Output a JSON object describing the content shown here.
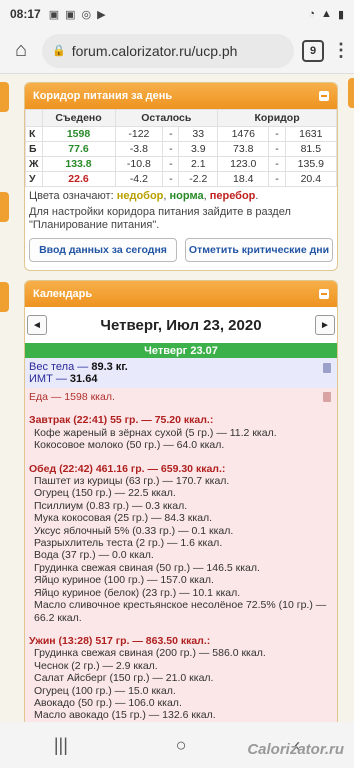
{
  "status": {
    "time": "08:17",
    "icons": [
      "image-icon",
      "image-icon",
      "instagram-icon",
      "youtube-icon"
    ],
    "battery": "▮"
  },
  "browser": {
    "url": "forum.calorizator.ru/ucp.ph",
    "tabs": "9"
  },
  "corridor": {
    "title": "Коридор питания за день",
    "headers": [
      "",
      "Съедено",
      "Осталось",
      "",
      "",
      "Коридор",
      "",
      ""
    ],
    "rows": [
      {
        "label": "К",
        "eaten": "1598",
        "left1": "-122",
        "left2": "33",
        "c1": "1476",
        "c2": "1631",
        "color": "green"
      },
      {
        "label": "Б",
        "eaten": "77.6",
        "left1": "-3.8",
        "left2": "3.9",
        "c1": "73.8",
        "c2": "81.5",
        "color": "green"
      },
      {
        "label": "Ж",
        "eaten": "133.8",
        "left1": "-10.8",
        "left2": "2.1",
        "c1": "123.0",
        "c2": "135.9",
        "color": "green"
      },
      {
        "label": "У",
        "eaten": "22.6",
        "left1": "-4.2",
        "left2": "-2.2",
        "c1": "18.4",
        "c2": "20.4",
        "color": "red"
      }
    ],
    "colors_label": "Цвета означают:",
    "legend_under": "недобор",
    "legend_norm": "норма",
    "legend_over": "перебор",
    "hint": "Для настройки коридора питания зайдите в раздел \"Планирование питания\".",
    "btn_today": "Ввод данных за сегодня",
    "btn_critical": "Отметить критические дни"
  },
  "calendar": {
    "title": "Календарь",
    "date": "Четверг, Июл 23, 2020",
    "prev": "◄",
    "next": "►",
    "day": "Четверг 23.07",
    "weight_label": "Вес тела —",
    "weight": "89.3 кг.",
    "bmi_label": "ИМТ —",
    "bmi": "31.64",
    "food_total": "Еда — 1598 ккал.",
    "meals": [
      {
        "head": "Завтрак (22:41) 55 гр. — 75.20 ккал.:",
        "items": [
          "Кофе жареный в зёрнах сухой (5 гр.) — 11.2 ккал.",
          "Кокосовое молоко (50 гр.) — 64.0 ккал."
        ]
      },
      {
        "head": "Обед (22:42) 461.16 гр. — 659.30 ккал.:",
        "items": [
          "Паштет из курицы (63 гр.) — 170.7 ккал.",
          "Огурец (150 гр.) — 22.5 ккал.",
          "Псиллиум (0.83 гр.) — 0.3 ккал.",
          "Мука кокосовая (25 гр.) — 84.3 ккал.",
          "Уксус яблочный 5% (0.33 гр.) — 0.1 ккал.",
          "Разрыхлитель теста (2 гр.) — 1.6 ккал.",
          "Вода (37 гр.) — 0.0 ккал.",
          "Грудинка свежая свиная (50 гр.) — 146.5 ккал.",
          "Яйцо куриное (100 гр.) — 157.0 ккал.",
          "Яйцо куриное (белок) (23 гр.) — 10.1 ккал.",
          "Масло сливочное крестьянское несолёное 72.5% (10 гр.) — 66.2 ккал."
        ]
      },
      {
        "head": "Ужин (13:28) 517 гр. — 863.50 ккал.:",
        "items": [
          "Грудинка свежая свиная (200 гр.) — 586.0 ккал.",
          "Чеснок (2 гр.) — 2.9 ккал.",
          "Салат Айсберг (150 гр.) — 21.0 ккал.",
          "Огурец (100 гр.) — 15.0 ккал.",
          "Авокадо (50 гр.) — 106.0 ккал.",
          "Масло авокадо (15 гр.) — 132.6 ккал."
        ]
      }
    ]
  },
  "watermark": "Calorizator.ru"
}
